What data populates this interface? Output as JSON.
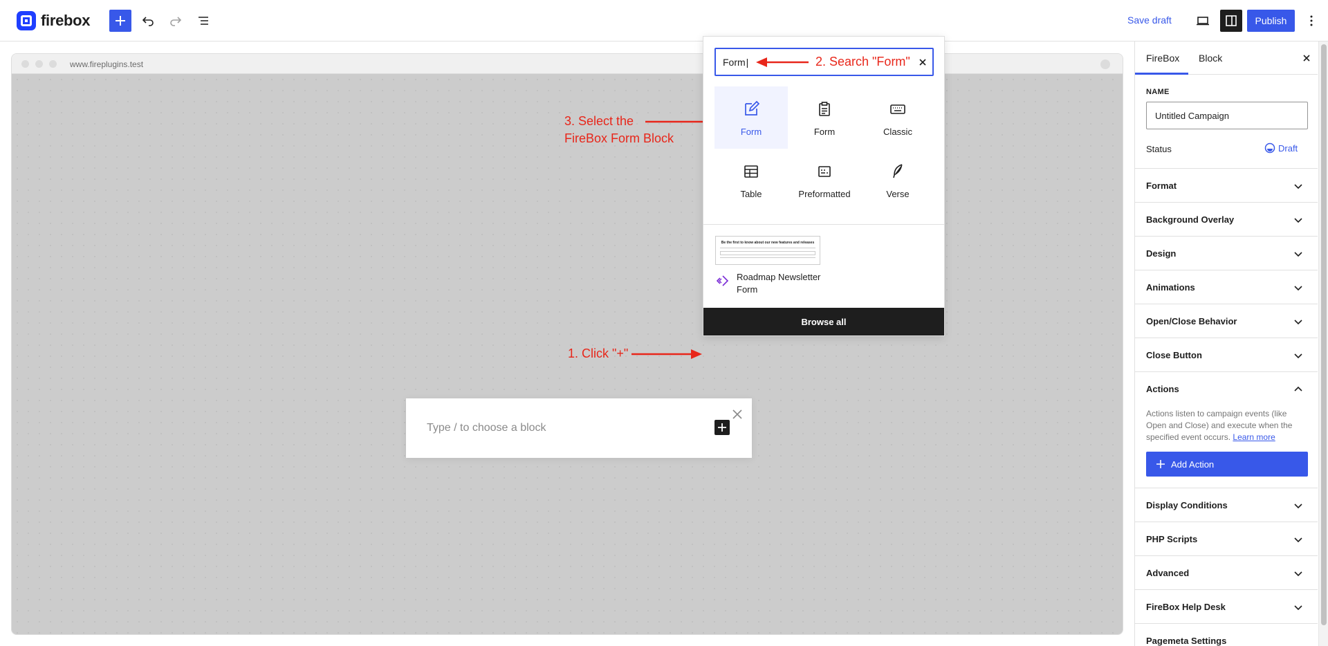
{
  "app": {
    "logo_text": "firebox"
  },
  "toolbar": {
    "save_draft": "Save draft",
    "publish": "Publish"
  },
  "browser": {
    "url": "www.fireplugins.test"
  },
  "popup": {
    "placeholder": "Type / to choose a block"
  },
  "annotations": {
    "step1": "1. Click \"+\"",
    "step2": "2. Search \"Form\"",
    "step3_line1": "3. Select the",
    "step3_line2": "FireBox Form Block",
    "color": "#e8261a"
  },
  "inserter": {
    "search_value": "Form",
    "blocks": [
      {
        "label": "Form",
        "icon": "edit-form-icon",
        "selected": true
      },
      {
        "label": "Form",
        "icon": "clipboard-icon",
        "selected": false
      },
      {
        "label": "Classic",
        "icon": "keyboard-icon",
        "selected": false
      },
      {
        "label": "Table",
        "icon": "table-icon",
        "selected": false
      },
      {
        "label": "Preformatted",
        "icon": "preformatted-icon",
        "selected": false
      },
      {
        "label": "Verse",
        "icon": "feather-icon",
        "selected": false
      }
    ],
    "pattern": {
      "name": "Roadmap Newsletter Form",
      "thumb_title": "Be the first to know about our new features and releases"
    },
    "browse_all": "Browse all"
  },
  "sidebar": {
    "tabs": [
      "FireBox",
      "Block"
    ],
    "name_label": "NAME",
    "name_value": "Untitled Campaign",
    "status_label": "Status",
    "status_value": "Draft",
    "panels": [
      "Format",
      "Background Overlay",
      "Design",
      "Animations",
      "Open/Close Behavior",
      "Close Button"
    ],
    "actions": {
      "title": "Actions",
      "description": "Actions listen to campaign events (like Open and Close) and execute when the specified event occurs.",
      "learn_more": "Learn more",
      "add_action": "Add Action"
    },
    "panels_after": [
      "Display Conditions",
      "PHP Scripts",
      "Advanced",
      "FireBox Help Desk"
    ],
    "partial_panel": "Pagemeta Settings"
  },
  "colors": {
    "accent": "#3858e9",
    "dark": "#1e1e1e"
  }
}
